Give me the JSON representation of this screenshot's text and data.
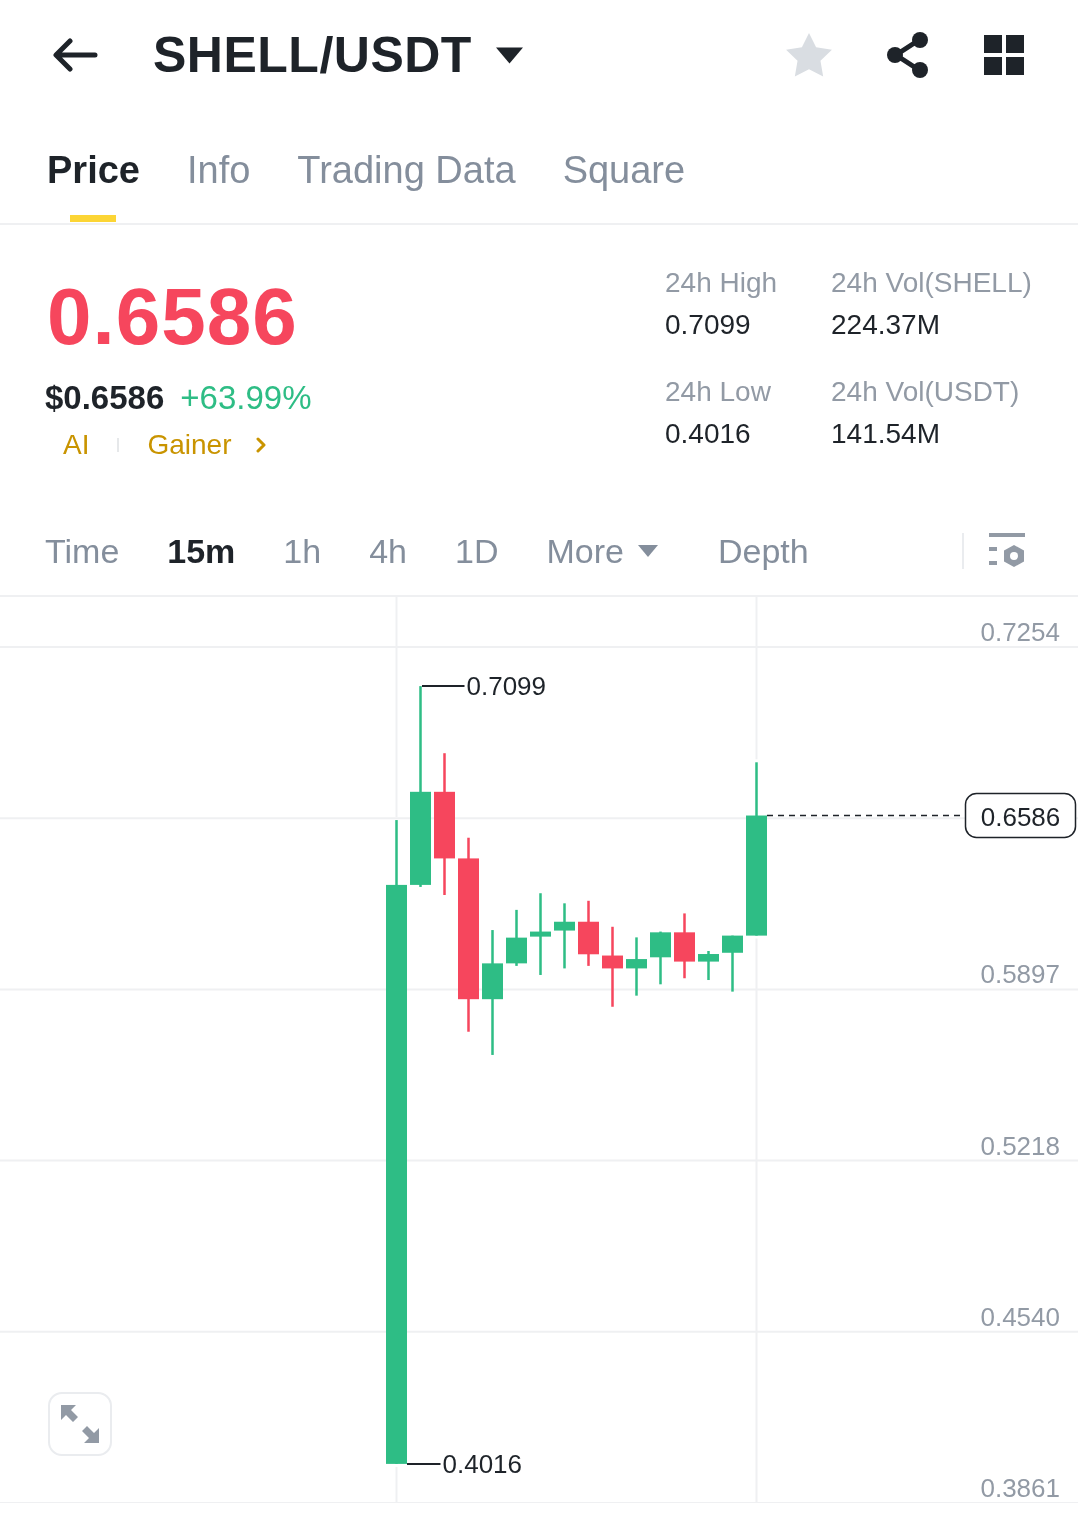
{
  "header": {
    "title": "SHELL/USDT",
    "favorited": false
  },
  "tabs": [
    {
      "label": "Price",
      "selected": true
    },
    {
      "label": "Info",
      "selected": false
    },
    {
      "label": "Trading Data",
      "selected": false
    },
    {
      "label": "Square",
      "selected": false
    }
  ],
  "ticker": {
    "last_price": "0.6586",
    "last_price_rising": false,
    "usd_price": "$0.6586",
    "change": "+63.99%",
    "change_rising": true,
    "tags": [
      {
        "label": "AI",
        "kind": "tag"
      },
      {
        "label": "Gainer",
        "kind": "link"
      }
    ],
    "stats": [
      {
        "label": "24h High",
        "value": "0.7099"
      },
      {
        "label": "24h Vol(SHELL)",
        "value": "224.37M"
      },
      {
        "label": "24h Low",
        "value": "0.4016"
      },
      {
        "label": "24h Vol(USDT)",
        "value": "141.54M"
      }
    ]
  },
  "intervals": [
    {
      "label": "Time",
      "selected": false,
      "kind": "option"
    },
    {
      "label": "15m",
      "selected": true,
      "kind": "option"
    },
    {
      "label": "1h",
      "selected": false,
      "kind": "option"
    },
    {
      "label": "4h",
      "selected": false,
      "kind": "option"
    },
    {
      "label": "1D",
      "selected": false,
      "kind": "option"
    },
    {
      "label": "More",
      "selected": false,
      "kind": "dropdown"
    },
    {
      "label": "Depth",
      "selected": false,
      "kind": "option"
    }
  ],
  "chart": {
    "axis_labels": [
      "0.7254",
      "0.5897",
      "0.5218",
      "0.4540",
      "0.3861"
    ],
    "high_label": "0.7099",
    "low_label": "0.4016",
    "last_price_tag": "0.6586"
  }
}
